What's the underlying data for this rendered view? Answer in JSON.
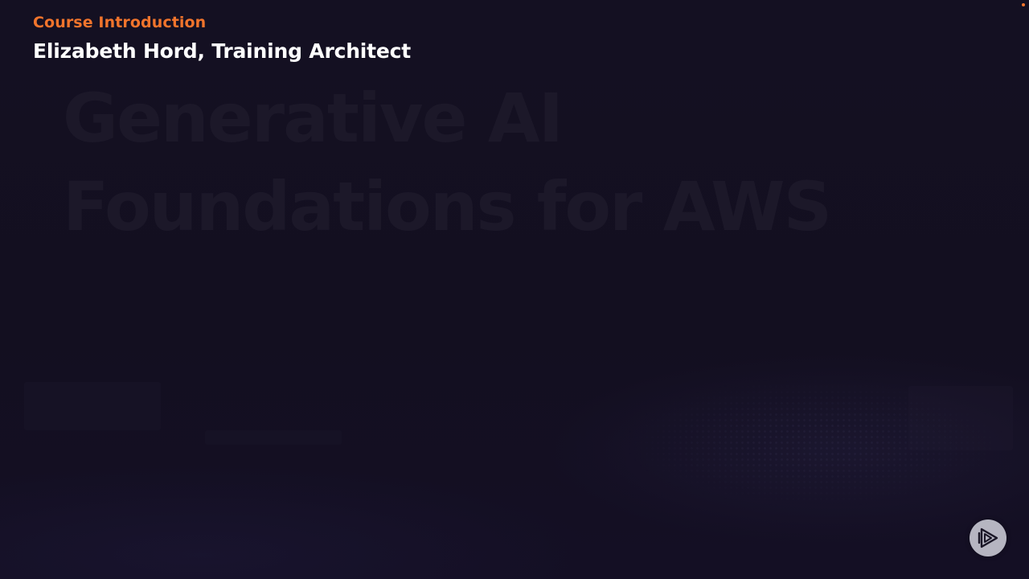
{
  "overlay": {
    "segment_label": "Course Introduction",
    "presenter": "Elizabeth Hord, Training Architect"
  },
  "slide": {
    "faded_title": "Generative AI\nFoundations for AWS"
  },
  "brand": {
    "icon": "play-logo-icon",
    "accent_color": "#f1742c",
    "background_color": "#130f1f"
  }
}
